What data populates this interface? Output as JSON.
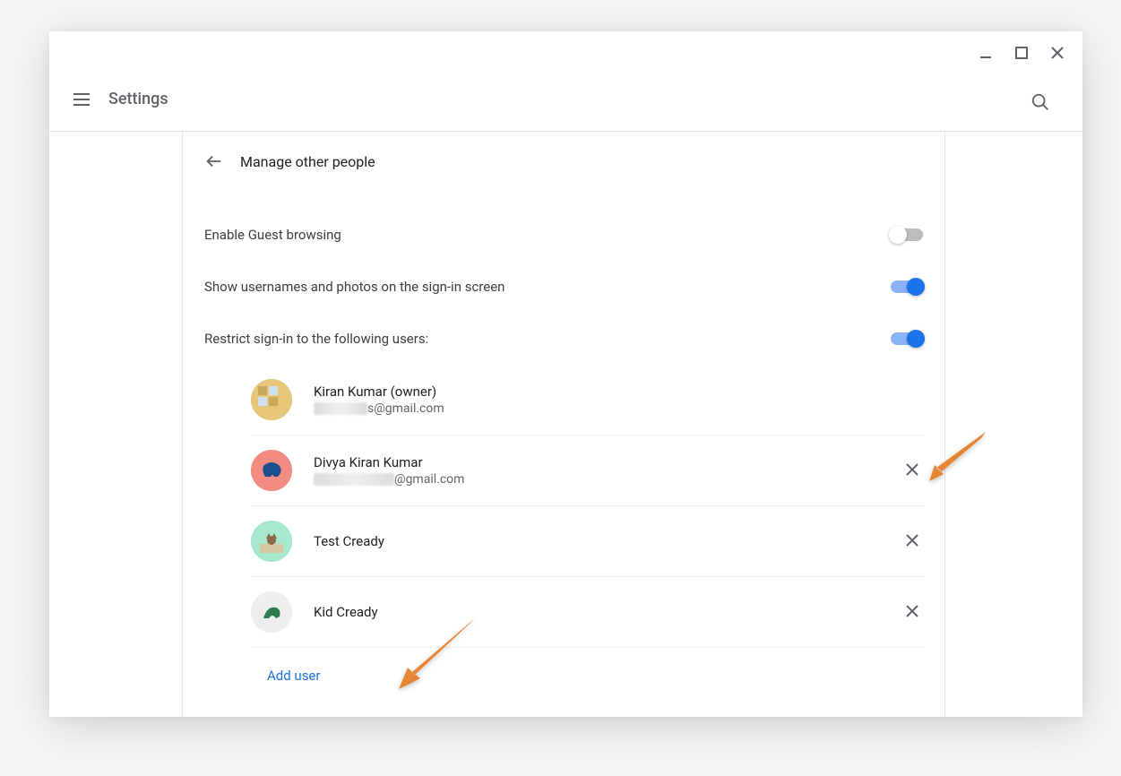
{
  "header": {
    "title": "Settings"
  },
  "subpage": {
    "title": "Manage other people"
  },
  "settings": {
    "guest_browsing": {
      "label": "Enable Guest browsing",
      "enabled": false
    },
    "show_usernames": {
      "label": "Show usernames and photos on the sign-in screen",
      "enabled": true
    },
    "restrict_signin": {
      "label": "Restrict sign-in to the following users:",
      "enabled": true
    }
  },
  "users": [
    {
      "name": "Kiran Kumar (owner)",
      "email_hidden_prefix": "            ",
      "email_suffix": "s@gmail.com",
      "removable": false,
      "avatar_bg": "#e6c77a",
      "avatar_shape": "grid"
    },
    {
      "name": "Divya Kiran Kumar",
      "email_hidden_prefix": "                  ",
      "email_suffix": "@gmail.com",
      "removable": true,
      "avatar_bg": "#f28b82",
      "avatar_shape": "elephant"
    },
    {
      "name": "Test Cready",
      "email_hidden_prefix": "",
      "email_suffix": "",
      "removable": true,
      "avatar_bg": "#a7e8cf",
      "avatar_shape": "cat"
    },
    {
      "name": "Kid Cready",
      "email_hidden_prefix": "",
      "email_suffix": "",
      "removable": true,
      "avatar_bg": "#eeeeee",
      "avatar_shape": "dragon"
    }
  ],
  "actions": {
    "add_user": "Add user"
  },
  "colors": {
    "accent": "#1a73e8",
    "arrow": "#e67722"
  }
}
